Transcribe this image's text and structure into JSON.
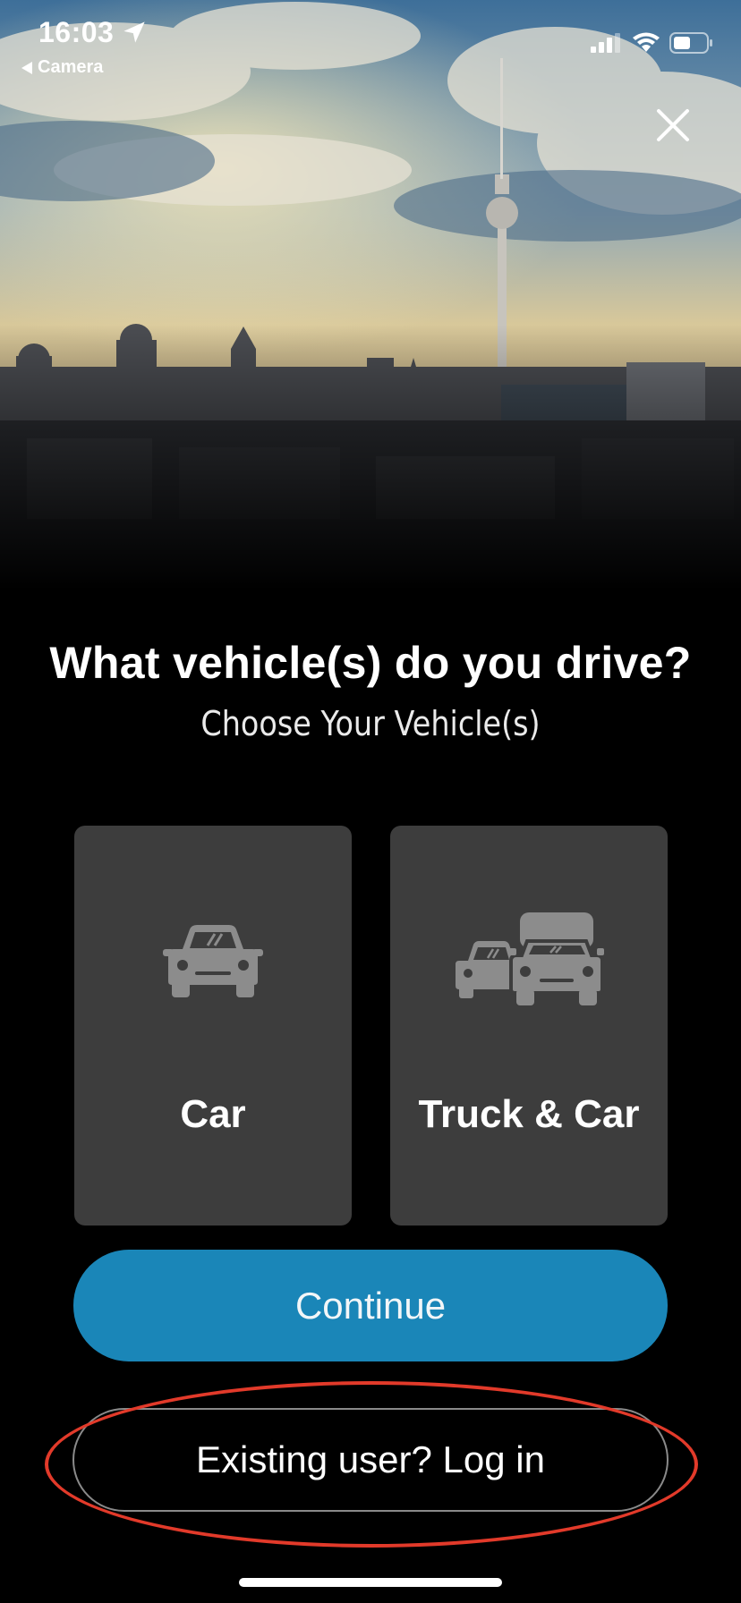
{
  "status_bar": {
    "time": "16:03",
    "back_app": "Camera",
    "icons": [
      "location-arrow-icon",
      "signal-icon",
      "wifi-icon",
      "battery-icon"
    ]
  },
  "header": {
    "close_icon": "close-icon"
  },
  "content": {
    "title": "What vehicle(s) do you drive?",
    "subtitle": "Choose Your Vehicle(s)"
  },
  "options": [
    {
      "label": "Car",
      "icon": "car-icon"
    },
    {
      "label": "Truck & Car",
      "icon": "truck-and-car-icon"
    }
  ],
  "actions": {
    "continue_label": "Continue",
    "login_label": "Existing user? Log in"
  },
  "colors": {
    "primary_button": "#1a86b8",
    "card_background": "#3d3d3d",
    "highlight_annotation": "#e23a2a"
  }
}
